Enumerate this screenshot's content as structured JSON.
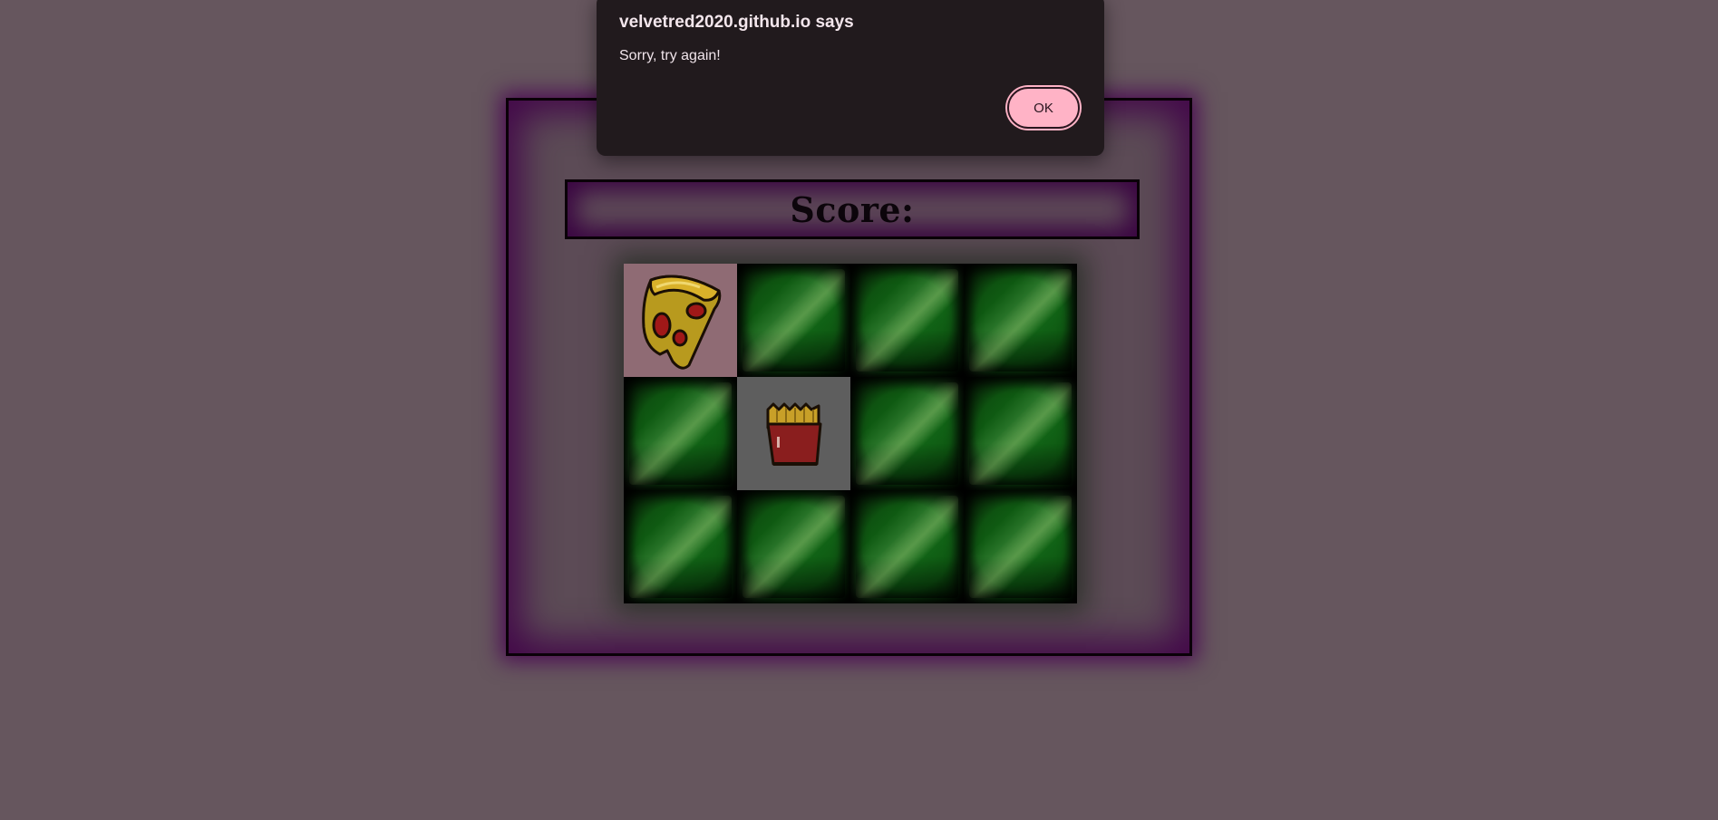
{
  "dialog": {
    "title": "velvetred2020.github.io says",
    "message": "Sorry, try again!",
    "ok_label": "OK"
  },
  "game": {
    "score_label": "Score:",
    "score_value": "",
    "grid": {
      "rows": 3,
      "columns": 4,
      "cards": [
        {
          "state": "face-up",
          "item": "pizza-icon"
        },
        {
          "state": "face-down",
          "item": "card-back"
        },
        {
          "state": "face-down",
          "item": "card-back"
        },
        {
          "state": "face-down",
          "item": "card-back"
        },
        {
          "state": "face-down",
          "item": "card-back"
        },
        {
          "state": "face-up",
          "item": "fries-icon"
        },
        {
          "state": "face-down",
          "item": "card-back"
        },
        {
          "state": "face-down",
          "item": "card-back"
        },
        {
          "state": "face-down",
          "item": "card-back"
        },
        {
          "state": "face-down",
          "item": "card-back"
        },
        {
          "state": "face-down",
          "item": "card-back"
        },
        {
          "state": "face-down",
          "item": "card-back"
        }
      ]
    }
  },
  "colors": {
    "page_background": "#66565e",
    "panel_glow": "#480052",
    "card_back_green": "#0f5a12",
    "dialog_background": "#211a1d",
    "ok_button": "#ffb3c6"
  }
}
